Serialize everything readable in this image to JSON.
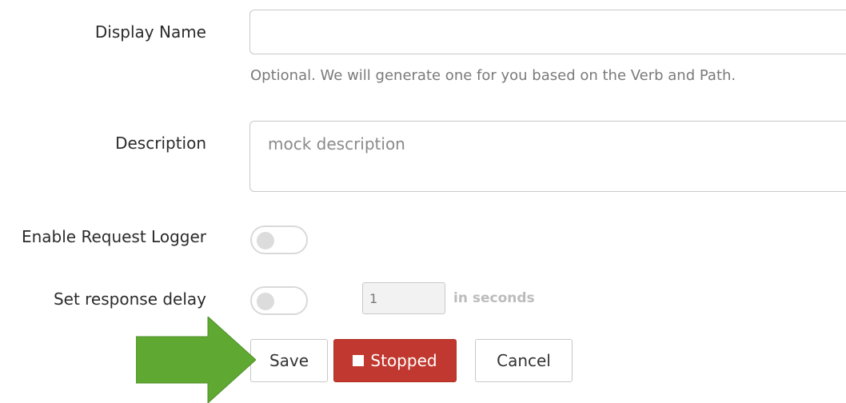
{
  "form": {
    "display_name": {
      "label": "Display Name",
      "value": "",
      "help": "Optional. We will generate one for you based on the Verb and Path."
    },
    "description": {
      "label": "Description",
      "placeholder": "mock description",
      "value": ""
    },
    "request_logger": {
      "label": "Enable Request Logger",
      "enabled": false
    },
    "response_delay": {
      "label": "Set response delay",
      "enabled": false,
      "value": "1",
      "unit": "in seconds"
    }
  },
  "actions": {
    "save_label": "Save",
    "stopped_label": "Stopped",
    "cancel_label": "Cancel"
  },
  "colors": {
    "stopped_button": "#c0382f",
    "arrow": "#5fa832"
  }
}
